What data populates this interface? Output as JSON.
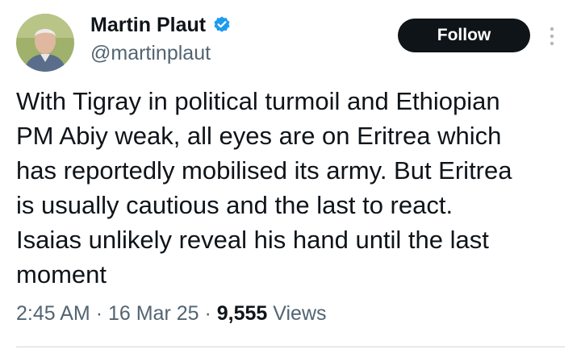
{
  "author": {
    "name": "Martin Plaut",
    "handle": "@martinplaut",
    "verified_color": "#1d9bf0"
  },
  "follow_label": "Follow",
  "tweet": {
    "text": "With Tigray in political turmoil and Ethiopian\nPM Abiy weak, all eyes are on Eritrea which\nhas reportedly mobilised its army.  But Eritrea\nis usually cautious and the last to react.\nIsaias unlikely reveal his hand until the last\nmoment"
  },
  "meta": {
    "time": "2:45 AM",
    "separator": "·",
    "date": "16 Mar 25",
    "views_count": "9,555",
    "views_label": "Views"
  },
  "icons": {
    "avatar": "profile-photo",
    "verified": "verified-badge-icon",
    "more": "more-options-icon"
  }
}
